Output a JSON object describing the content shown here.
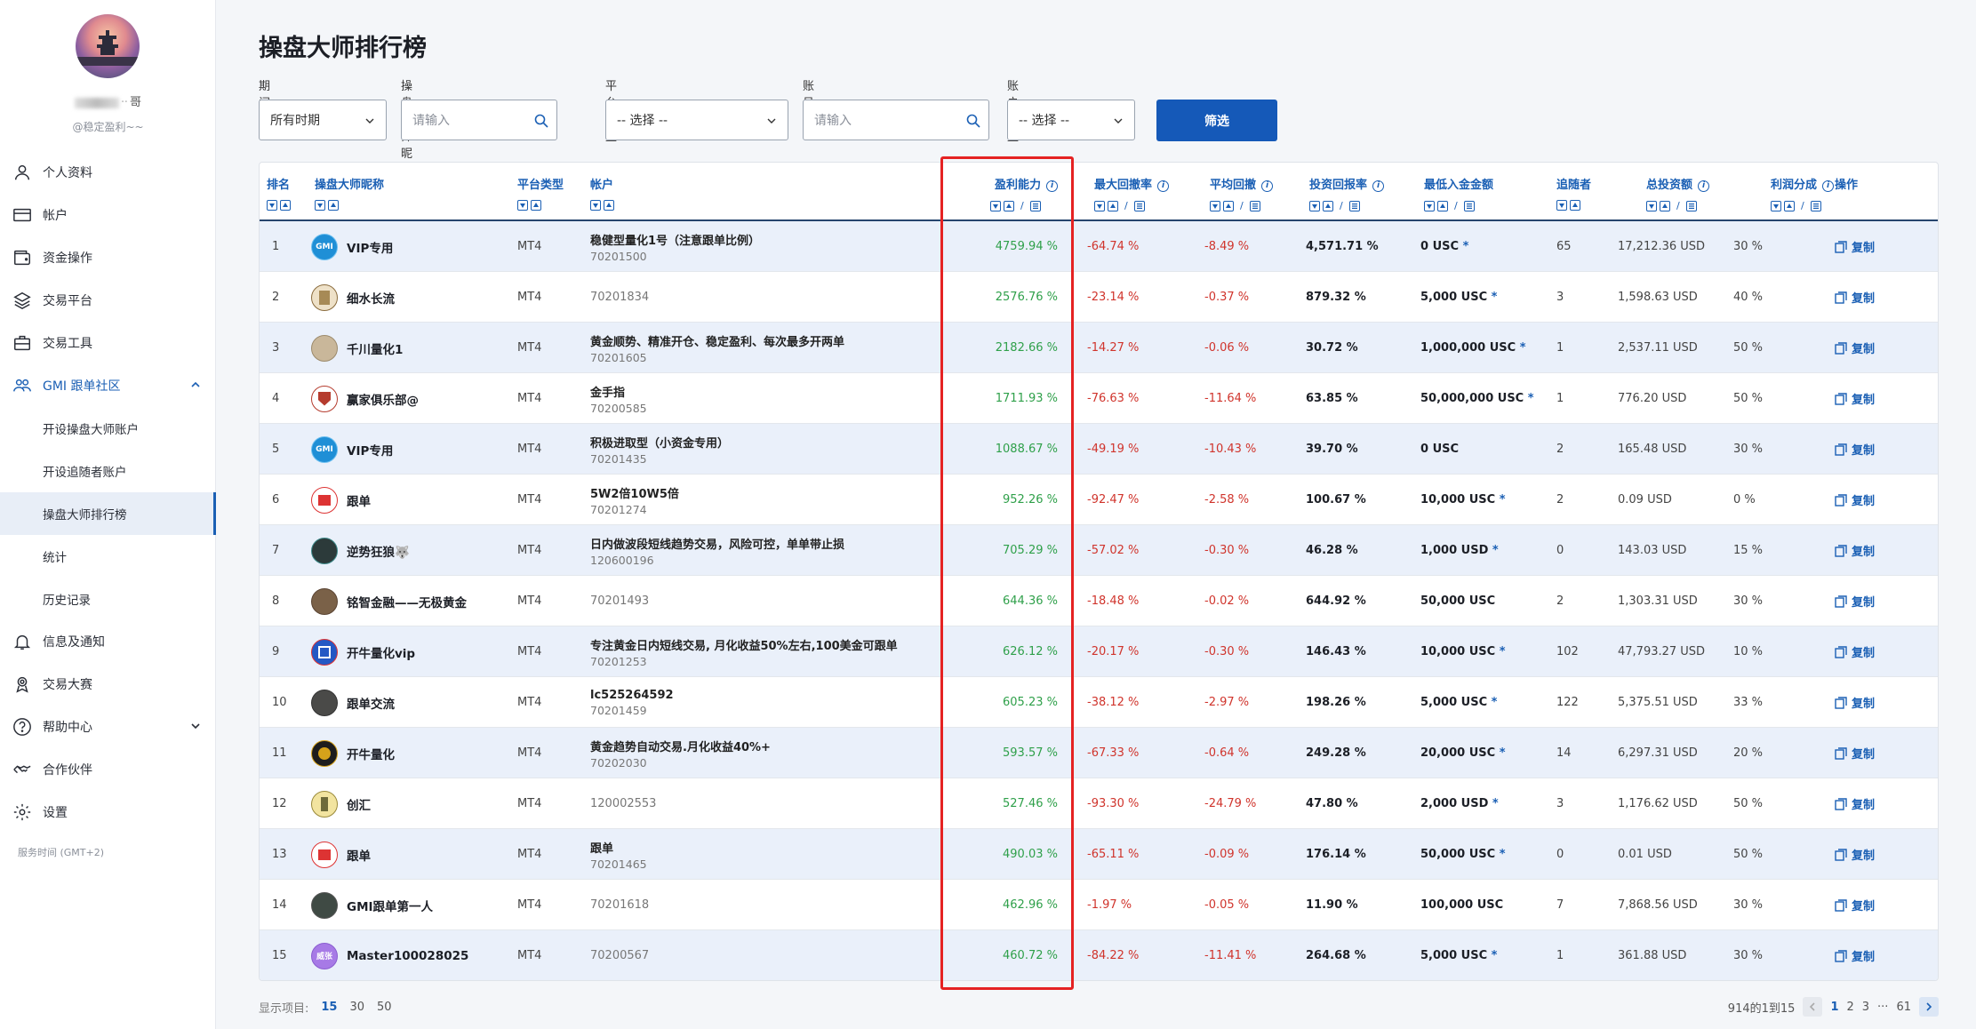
{
  "sidebar": {
    "username_visible": "ᆢ哥",
    "usertag": "@稳定盈利~~",
    "items": [
      {
        "label": "个人资料",
        "icon": "user-icon"
      },
      {
        "label": "帐户",
        "icon": "card-icon"
      },
      {
        "label": "资金操作",
        "icon": "wallet-icon"
      },
      {
        "label": "交易平台",
        "icon": "layers-icon"
      },
      {
        "label": "交易工具",
        "icon": "briefcase-icon"
      },
      {
        "label": "GMI 跟单社区",
        "icon": "community-icon"
      }
    ],
    "sub_items": [
      "开设操盘大师账户",
      "开设追随者账户",
      "操盘大师排行榜",
      "统计",
      "历史记录"
    ],
    "active_sub": "操盘大师排行榜",
    "items2": [
      {
        "label": "信息及通知",
        "icon": "bell-icon"
      },
      {
        "label": "交易大赛",
        "icon": "trophy-icon"
      },
      {
        "label": "帮助中心",
        "icon": "help-icon"
      },
      {
        "label": "合作伙伴",
        "icon": "handshake-icon"
      },
      {
        "label": "设置",
        "icon": "gear-icon"
      }
    ],
    "server_time": "服务时间 (GMT+2)"
  },
  "page": {
    "title": "操盘大师排行榜"
  },
  "filters": {
    "period_label": "期间",
    "period_value": "所有时期",
    "name_label": "操盘大师昵称",
    "name_placeholder": "请输入",
    "platform_label": "平台类型",
    "platform_value": "-- 选择 --",
    "account_label": "账号",
    "account_placeholder": "请输入",
    "acct_type_label": "账户类型",
    "acct_type_value": "-- 选择 --",
    "submit": "筛选"
  },
  "table": {
    "headers": [
      "排名",
      "操盘大师昵称",
      "平台类型",
      "帐户",
      "盈利能力",
      "最大回撤率",
      "平均回撤",
      "投资回报率",
      "最低入金金额",
      "追随者",
      "总投资额",
      "利润分成",
      "操作"
    ],
    "copy_label": "复制",
    "rows": [
      {
        "rank": "1",
        "name": "VIP专用",
        "platform": "MT4",
        "acct_title": "稳健型量化1号（注意跟单比例）",
        "acct": "70201500",
        "profit": "4759.94 %",
        "maxdd": "-64.74 %",
        "avgdd": "-8.49 %",
        "roi": "4,571.71 %",
        "min": "0 USC",
        "star": "*",
        "followers": "65",
        "total": "17,212.36 USD",
        "share": "30 %",
        "av": "gmi"
      },
      {
        "rank": "2",
        "name": "细水长流",
        "platform": "MT4",
        "acct_title": "",
        "acct": "70201834",
        "profit": "2576.76 %",
        "maxdd": "-23.14 %",
        "avgdd": "-0.37 %",
        "roi": "879.32 %",
        "min": "5,000 USC",
        "star": "*",
        "followers": "3",
        "total": "1,598.63 USD",
        "share": "40 %",
        "av": "card"
      },
      {
        "rank": "3",
        "name": "千川量化1",
        "platform": "MT4",
        "acct_title": "黄金顺势、精准开仓、稳定盈利、每次最多开两单",
        "acct": "70201605",
        "profit": "2182.66 %",
        "maxdd": "-14.27 %",
        "avgdd": "-0.06 %",
        "roi": "30.72 %",
        "min": "1,000,000 USC",
        "star": "*",
        "followers": "1",
        "total": "2,537.11 USD",
        "share": "50 %",
        "av": "beige"
      },
      {
        "rank": "4",
        "name": "赢家俱乐部@",
        "platform": "MT4",
        "acct_title": "金手指",
        "acct": "70200585",
        "profit": "1711.93 %",
        "maxdd": "-76.63 %",
        "avgdd": "-11.64 %",
        "roi": "63.85 %",
        "min": "50,000,000 USC",
        "star": "*",
        "followers": "1",
        "total": "776.20 USD",
        "share": "50 %",
        "av": "shield"
      },
      {
        "rank": "5",
        "name": "VIP专用",
        "platform": "MT4",
        "acct_title": "积极进取型（小资金专用）",
        "acct": "70201435",
        "profit": "1088.67 %",
        "maxdd": "-49.19 %",
        "avgdd": "-10.43 %",
        "roi": "39.70 %",
        "min": "0 USC",
        "star": "",
        "followers": "2",
        "total": "165.48 USD",
        "share": "30 %",
        "av": "gmi"
      },
      {
        "rank": "6",
        "name": "跟单",
        "platform": "MT4",
        "acct_title": "5W2倍10W5倍",
        "acct": "70201274",
        "profit": "952.26 %",
        "maxdd": "-92.47 %",
        "avgdd": "-2.58 %",
        "roi": "100.67 %",
        "min": "10,000 USC",
        "star": "*",
        "followers": "2",
        "total": "0.09 USD",
        "share": "0 %",
        "av": "redlogo"
      },
      {
        "rank": "7",
        "name": "逆势狂狼🐺",
        "platform": "MT4",
        "acct_title": "日内做波段短线趋势交易，风险可控，单单带止损",
        "acct": "120600196",
        "profit": "705.29 %",
        "maxdd": "-57.02 %",
        "avgdd": "-0.30 %",
        "roi": "46.28 %",
        "min": "1,000 USD",
        "star": "*",
        "followers": "0",
        "total": "143.03 USD",
        "share": "15 %",
        "av": "dark"
      },
      {
        "rank": "8",
        "name": "铭智金融——无极黄金",
        "platform": "MT4",
        "acct_title": "",
        "acct": "70201493",
        "profit": "644.36 %",
        "maxdd": "-18.48 %",
        "avgdd": "-0.02 %",
        "roi": "644.92 %",
        "min": "50,000 USC",
        "star": "",
        "followers": "2",
        "total": "1,303.31 USD",
        "share": "30 %",
        "av": "brown"
      },
      {
        "rank": "9",
        "name": "开牛量化vip",
        "platform": "MT4",
        "acct_title": "专注黄金日内短线交易, 月化收益50%左右,100美金可跟单",
        "acct": "70201253",
        "profit": "626.12 %",
        "maxdd": "-20.17 %",
        "avgdd": "-0.30 %",
        "roi": "146.43 %",
        "min": "10,000 USC",
        "star": "*",
        "followers": "102",
        "total": "47,793.27 USD",
        "share": "10 %",
        "av": "blue"
      },
      {
        "rank": "10",
        "name": "跟单交流",
        "platform": "MT4",
        "acct_title": "lc525264592",
        "acct": "70201459",
        "profit": "605.23 %",
        "maxdd": "-38.12 %",
        "avgdd": "-2.97 %",
        "roi": "198.26 %",
        "min": "5,000 USC",
        "star": "*",
        "followers": "122",
        "total": "5,375.51 USD",
        "share": "33 %",
        "av": "darkgrey"
      },
      {
        "rank": "11",
        "name": "开牛量化",
        "platform": "MT4",
        "acct_title": "黄金趋势自动交易.月化收益40%+",
        "acct": "70202030",
        "profit": "593.57 %",
        "maxdd": "-67.33 %",
        "avgdd": "-0.64 %",
        "roi": "249.28 %",
        "min": "20,000 USC",
        "star": "*",
        "followers": "14",
        "total": "6,297.31 USD",
        "share": "20 %",
        "av": "gold"
      },
      {
        "rank": "12",
        "name": "创汇",
        "platform": "MT4",
        "acct_title": "",
        "acct": "120002553",
        "profit": "527.46 %",
        "maxdd": "-93.30 %",
        "avgdd": "-24.79 %",
        "roi": "47.80 %",
        "min": "2,000 USD",
        "star": "*",
        "followers": "3",
        "total": "1,176.62 USD",
        "share": "50 %",
        "av": "yellow"
      },
      {
        "rank": "13",
        "name": "跟单",
        "platform": "MT4",
        "acct_title": "跟单",
        "acct": "70201465",
        "profit": "490.03 %",
        "maxdd": "-65.11 %",
        "avgdd": "-0.09 %",
        "roi": "176.14 %",
        "min": "50,000 USC",
        "star": "*",
        "followers": "0",
        "total": "0.01 USD",
        "share": "50 %",
        "av": "redlogo"
      },
      {
        "rank": "14",
        "name": "GMI跟单第一人",
        "platform": "MT4",
        "acct_title": "",
        "acct": "70201618",
        "profit": "462.96 %",
        "maxdd": "-1.97 %",
        "avgdd": "-0.05 %",
        "roi": "11.90 %",
        "min": "100,000 USC",
        "star": "",
        "followers": "7",
        "total": "7,868.56 USD",
        "share": "30 %",
        "av": "grey"
      },
      {
        "rank": "15",
        "name": "Master100028025",
        "platform": "MT4",
        "acct_title": "",
        "acct": "70200567",
        "profit": "460.72 %",
        "maxdd": "-84.22 %",
        "avgdd": "-11.41 %",
        "roi": "264.68 %",
        "min": "5,000 USC",
        "star": "*",
        "followers": "1",
        "total": "361.88 USD",
        "share": "30 %",
        "av": "purple"
      }
    ]
  },
  "avatar_text": {
    "gmi": "GMI",
    "purple": "威张"
  },
  "pager": {
    "show_label": "显示项目:",
    "options": [
      "15",
      "30",
      "50"
    ],
    "selected": "15",
    "summary": "914的1到15",
    "pages": [
      "1",
      "2",
      "3"
    ],
    "ellipsis": "···",
    "last": "61"
  }
}
